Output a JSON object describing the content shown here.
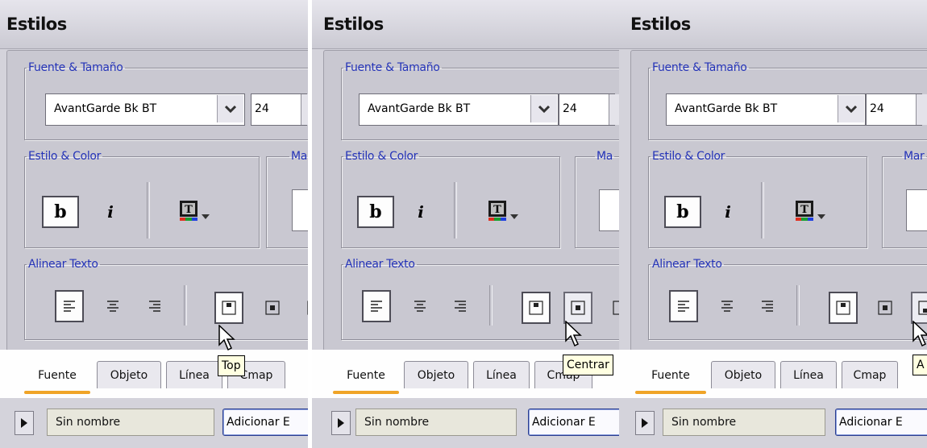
{
  "panels": [
    {
      "title": "Estilos",
      "font_group_label": "Fuente & Tamaño",
      "font_value": "AvantGarde Bk BT",
      "size_value": "24",
      "style_group_label": "Estilo & Color",
      "margin_group_label": "Mar",
      "bold_label": "b",
      "italic_label": "i",
      "align_group_label": "Alinear Texto",
      "tabs": [
        "Fuente",
        "Objeto",
        "Línea",
        "Cmap"
      ],
      "name_value": "Sin nombre",
      "add_button_label": "Adicionar E",
      "tooltip": "Top"
    },
    {
      "title": "Estilos",
      "font_group_label": "Fuente & Tamaño",
      "font_value": "AvantGarde Bk BT",
      "size_value": "24",
      "style_group_label": "Estilo & Color",
      "margin_group_label": "Ma",
      "bold_label": "b",
      "italic_label": "i",
      "align_group_label": "Alinear Texto",
      "tabs": [
        "Fuente",
        "Objeto",
        "Línea",
        "Cmap"
      ],
      "name_value": "Sin nombre",
      "add_button_label": "Adicionar E",
      "tooltip": "Centrar"
    },
    {
      "title": "Estilos",
      "font_group_label": "Fuente & Tamaño",
      "font_value": "AvantGarde Bk BT",
      "size_value": "24",
      "style_group_label": "Estilo & Color",
      "margin_group_label": "Mar",
      "bold_label": "b",
      "italic_label": "i",
      "align_group_label": "Alinear Texto",
      "tabs": [
        "Fuente",
        "Objeto",
        "Línea",
        "Cmap"
      ],
      "name_value": "Sin nombre",
      "add_button_label": "Adicionar E",
      "tooltip": "A"
    }
  ],
  "colors": {
    "legend": "#2433b8",
    "tab_accent": "#f0a428",
    "panel_bg": "#d4d3db",
    "tooltip_bg": "#ffffe1"
  }
}
